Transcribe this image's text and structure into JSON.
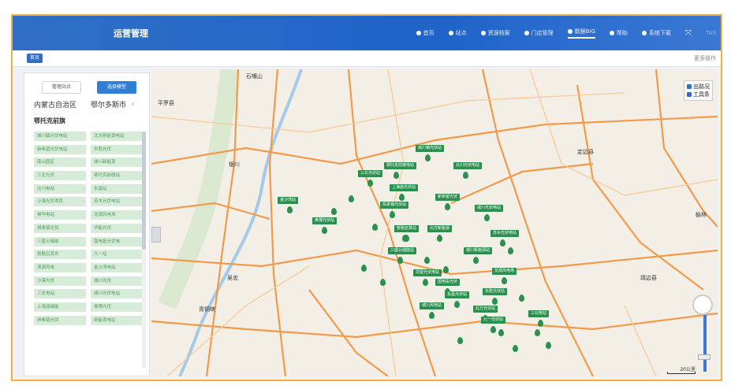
{
  "app": {
    "title": "运营管理"
  },
  "nav": [
    {
      "label": "首页",
      "icon": "home-icon"
    },
    {
      "label": "站点",
      "icon": "station-icon"
    },
    {
      "label": "资源档案",
      "icon": "archive-icon"
    },
    {
      "label": "门店管理",
      "icon": "send-icon"
    },
    {
      "label": "数据BIG",
      "icon": "data-icon",
      "active": true
    },
    {
      "label": "帮助",
      "icon": "help-icon"
    },
    {
      "label": "系统下载",
      "icon": "download-icon"
    }
  ],
  "nav_extra": "TAS",
  "subbar": {
    "home_tab": "首页",
    "more_ops": "更多操作"
  },
  "left_panel": {
    "mode_a": "管理站点",
    "mode_b": "选择模型",
    "region_left": "内蒙古自治区",
    "region_right": "鄂尔多斯市",
    "banner": "鄂托克前旗",
    "sites_col1": [
      "城川镇光伏电站",
      "新希望光伏电站",
      "南山园区",
      "三北光伏",
      "北川电站",
      "沙漠光伏项目",
      "昊华电站",
      "昂素镇光伏",
      "三盛公储能",
      "敖勒召其东",
      "清源风电",
      "沙漠光伏",
      "三北电站",
      "上海庙储能",
      "昂素镇光伏"
    ],
    "sites_col2": [
      "北方新能源电站",
      "东胜光伏",
      "城川新能源",
      "鄂托克前旗站",
      "永昌站",
      "苏木光伏电站",
      "龙源风电场",
      "华能光伏",
      "国电投光伏电",
      "九一站",
      "金沙湾电站",
      "城川光伏",
      "城川光伏电站",
      "奥博光伏",
      "新能源电站"
    ]
  },
  "map": {
    "cities": [
      {
        "name": "石嘴山"
      },
      {
        "name": "平罗县"
      },
      {
        "name": "银川"
      },
      {
        "name": "榆林"
      },
      {
        "name": "定边县"
      },
      {
        "name": "青铜峡"
      },
      {
        "name": "吴忠"
      },
      {
        "name": "靖边县"
      }
    ],
    "stations": [
      "城川镇光伏站",
      "鄂托克前旗电站",
      "北川光伏电站",
      "三北光伏站",
      "上海庙光伏站",
      "新希望光伏",
      "昂素镇光伏站",
      "城川光伏电站",
      "敖勒召其站",
      "北方新能源",
      "苏木光伏电站",
      "三盛公储能站",
      "城川新能源站",
      "龙源风电场",
      "华能光伏电站",
      "国电投光伏",
      "东胜光伏站",
      "永昌光伏站",
      "北方光伏站",
      "九一光伏站",
      "金沙湾站",
      "奥博光伏站",
      "城川风电站",
      "三北电站"
    ],
    "overlay": {
      "show_traffic": "出路况",
      "toolbar": "工具条"
    },
    "scale": "20公里"
  }
}
